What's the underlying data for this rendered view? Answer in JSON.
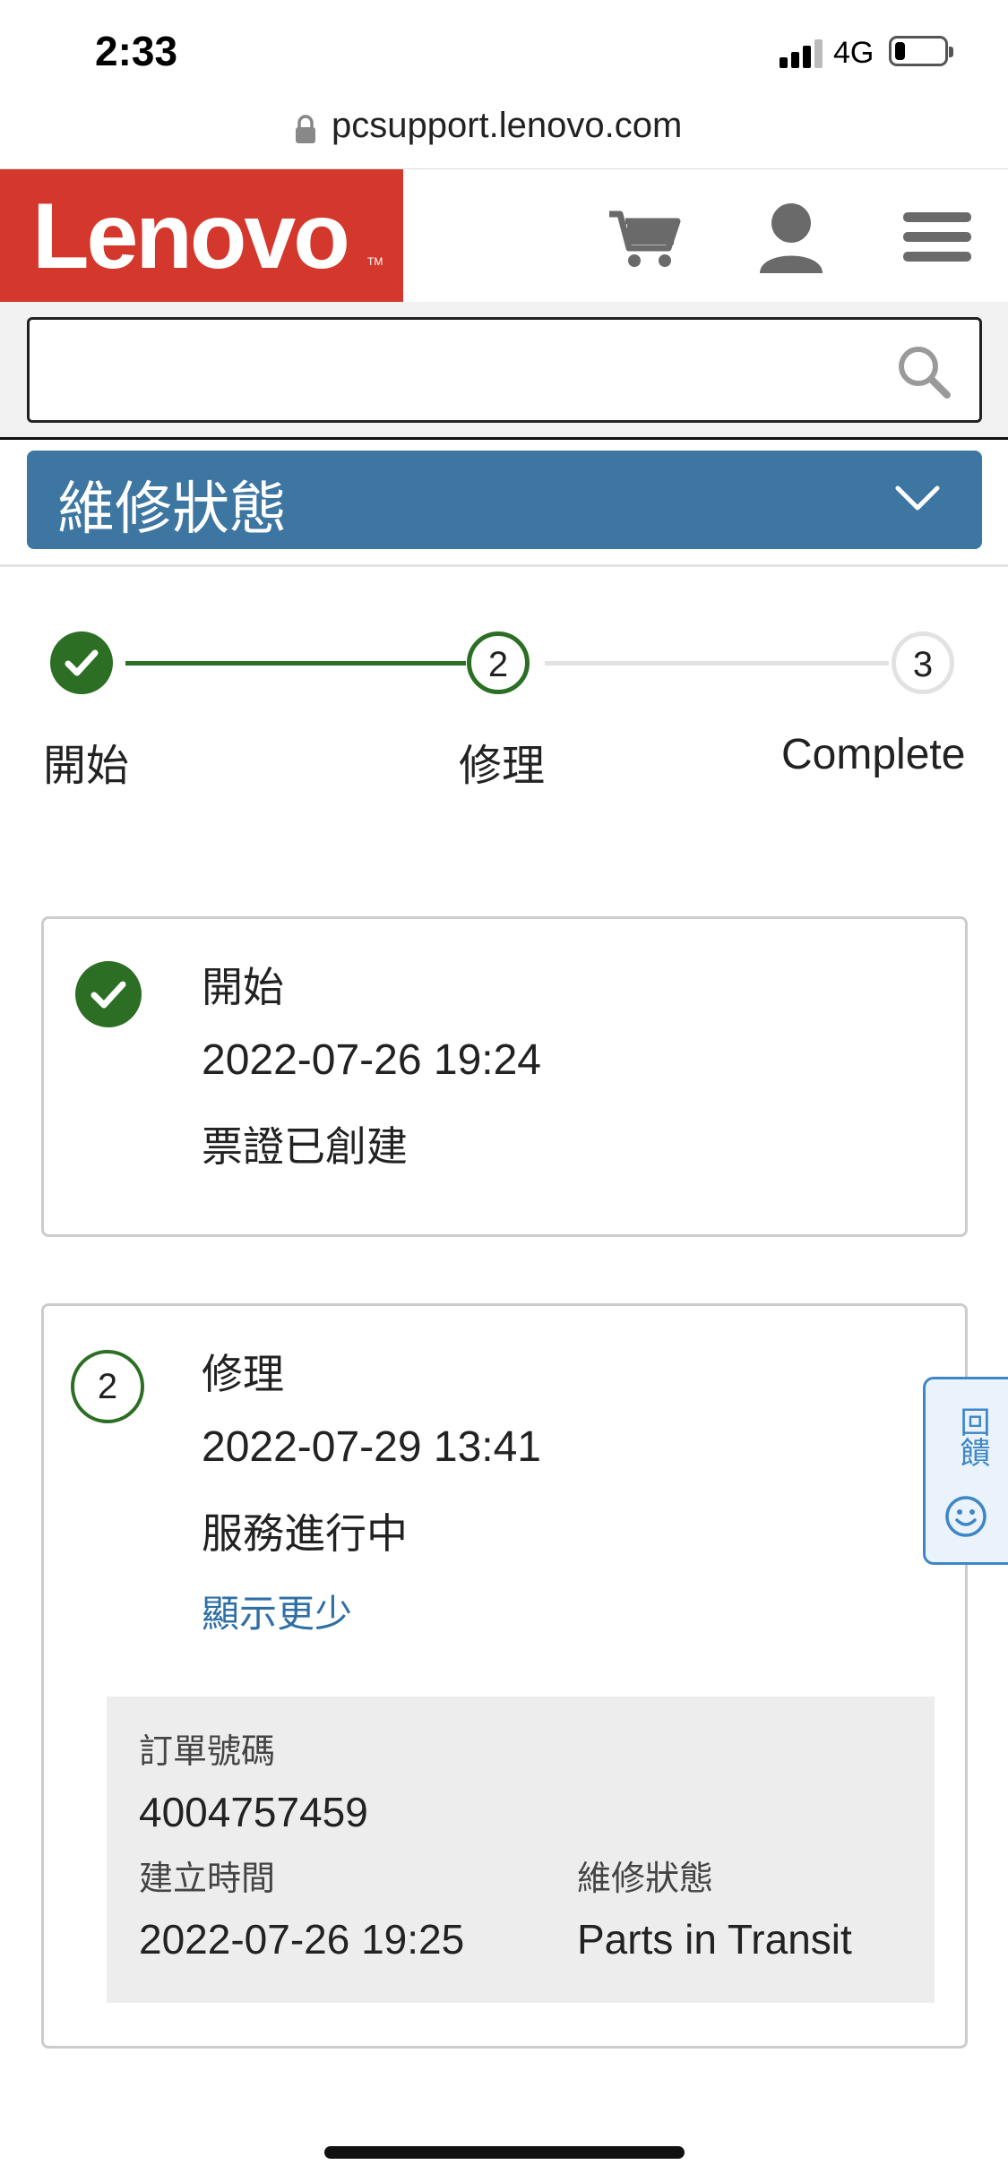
{
  "status_bar": {
    "time": "2:33",
    "network": "4G",
    "battery_level": 0.22
  },
  "browser": {
    "url": "pcsupport.lenovo.com"
  },
  "header": {
    "logo_text": "Lenovo",
    "logo_tm": "TM",
    "cart_icon": "cart-icon",
    "account_icon": "user-icon",
    "menu_icon": "hamburger-menu-icon"
  },
  "search": {
    "placeholder": "",
    "value": ""
  },
  "section": {
    "title": "維修狀態"
  },
  "stepper": {
    "steps": [
      {
        "label": "開始",
        "number": "1",
        "state": "done"
      },
      {
        "label": "修理",
        "number": "2",
        "state": "current"
      },
      {
        "label": "Complete",
        "number": "3",
        "state": "pending"
      }
    ]
  },
  "cards": [
    {
      "title": "開始",
      "time": "2022-07-26 19:24",
      "desc": "票證已創建"
    },
    {
      "number": "2",
      "title": "修理",
      "time": "2022-07-29 13:41",
      "desc": "服務進行中",
      "toggle_link": "顯示更少",
      "details": {
        "order_label": "訂單號碼",
        "order_value": "4004757459",
        "created_label": "建立時間",
        "created_value": "2022-07-26 19:25",
        "status_label": "維修狀態",
        "status_value": "Parts in Transit"
      }
    }
  ],
  "feedback": {
    "label": "回饋"
  },
  "colors": {
    "lenovo_red": "#d4372b",
    "section_blue": "#3e76a2",
    "success_green": "#2c6e24",
    "link_blue": "#2f6fa4"
  }
}
